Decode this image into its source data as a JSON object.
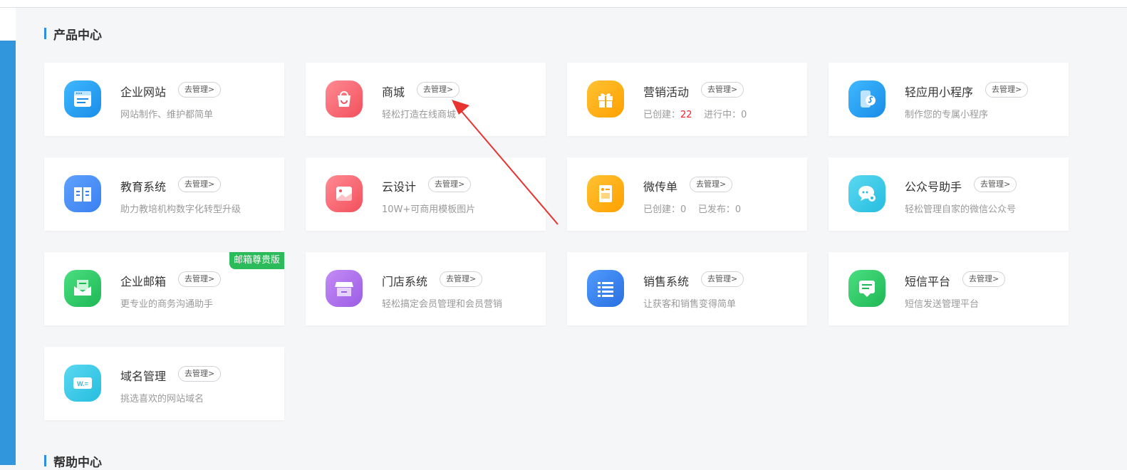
{
  "section": {
    "title": "产品中心",
    "next_title": "帮助中心"
  },
  "colors": {
    "accent": "#2b8fe8",
    "sidebar": "#3296dc",
    "badge": "#2cbb5a",
    "count_red": "#f5222d"
  },
  "cards": [
    {
      "name": "企业网站",
      "manage": "去管理>",
      "desc": "网站制作、维护都简单",
      "icon": "website-icon"
    },
    {
      "name": "商城",
      "manage": "去管理>",
      "desc": "轻松打造在线商城",
      "icon": "shopping-bag-icon"
    },
    {
      "name": "营销活动",
      "manage": "去管理>",
      "stat1_label": "已创建：",
      "stat1_value": "22",
      "stat2_label": "进行中：",
      "stat2_value": "0",
      "icon": "gift-icon"
    },
    {
      "name": "轻应用小程序",
      "manage": "去管理>",
      "desc": "制作您的专属小程序",
      "icon": "mini-program-icon"
    },
    {
      "name": "教育系统",
      "manage": "去管理>",
      "desc": "助力教培机构数字化转型升级",
      "icon": "book-icon"
    },
    {
      "name": "云设计",
      "manage": "去管理>",
      "desc": "10W+可商用模板图片",
      "icon": "image-icon"
    },
    {
      "name": "微传单",
      "manage": "去管理>",
      "stat1_label": "已创建：",
      "stat1_value": "0",
      "stat2_label": "已发布：",
      "stat2_value": "0",
      "icon": "flyer-icon"
    },
    {
      "name": "公众号助手",
      "manage": "去管理>",
      "desc": "轻松管理自家的微信公众号",
      "icon": "wechat-icon"
    },
    {
      "name": "企业邮箱",
      "manage": "去管理>",
      "desc": "更专业的商务沟通助手",
      "badge": "邮箱尊贵版",
      "icon": "mail-icon"
    },
    {
      "name": "门店系统",
      "manage": "去管理>",
      "desc": "轻松搞定会员管理和会员营销",
      "icon": "store-icon"
    },
    {
      "name": "销售系统",
      "manage": "去管理>",
      "desc": "让获客和销售变得简单",
      "icon": "list-icon"
    },
    {
      "name": "短信平台",
      "manage": "去管理>",
      "desc": "短信发送管理平台",
      "icon": "sms-icon"
    },
    {
      "name": "域名管理",
      "manage": "去管理>",
      "desc": "挑选喜欢的网站域名",
      "icon": "domain-icon"
    }
  ]
}
